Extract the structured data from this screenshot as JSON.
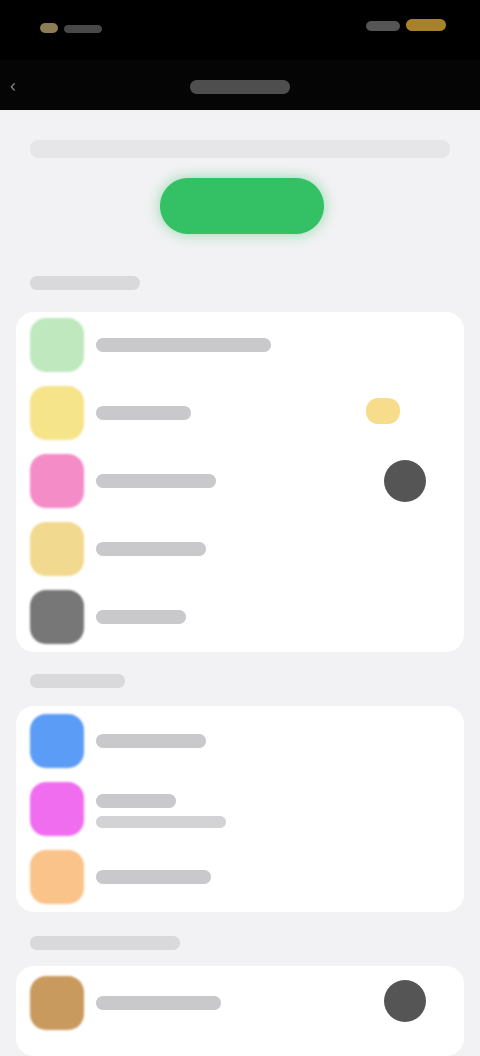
{
  "colors": {
    "accent_green": "#34c065",
    "icon_green": "#bfe8bf",
    "icon_yellow": "#f6e48a",
    "icon_pink": "#f48cc8",
    "icon_tan": "#f1d98f",
    "icon_gray": "#777777",
    "icon_blue": "#5b9cf6",
    "icon_magenta": "#f06df0",
    "icon_orange": "#fac389",
    "icon_brown": "#c99a5e",
    "badge_yellow": "#f3cf5a",
    "badge_dark": "#555555"
  },
  "icons": {
    "back": "chevron-left-icon"
  }
}
